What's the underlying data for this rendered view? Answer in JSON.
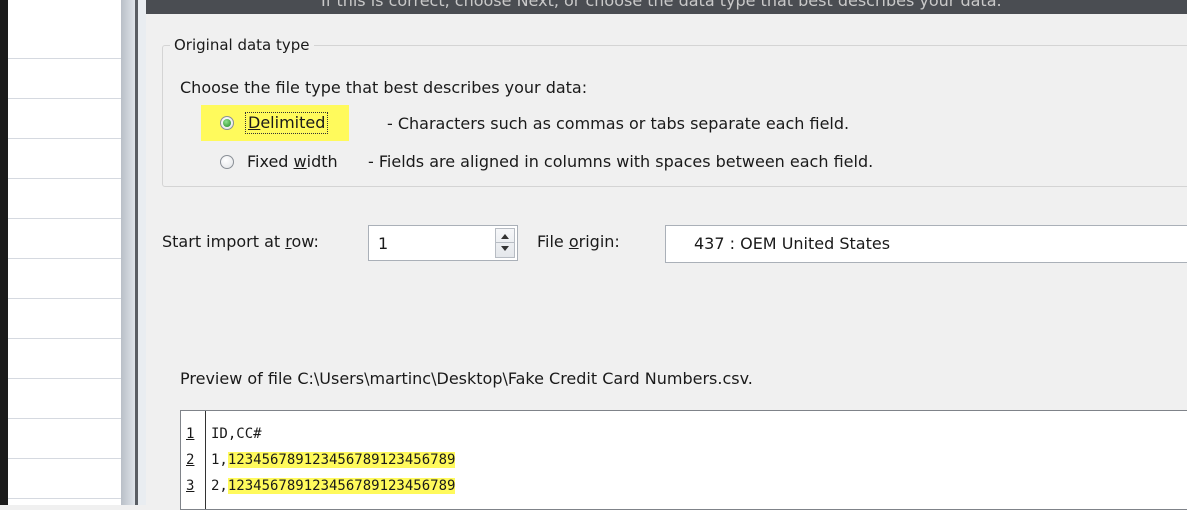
{
  "window": {
    "cutoff_text": "If this is correct, choose Next, or choose the data type that best describes your data."
  },
  "group": {
    "legend": "Original data type",
    "choose_text": "Choose the file type that best describes your data:",
    "delimited": {
      "label_pre": "",
      "label_key": "D",
      "label_post": "elimited",
      "description": "- Characters such as commas or tabs separate each field.",
      "selected": true
    },
    "fixed": {
      "label_pre": "Fixed ",
      "label_key": "w",
      "label_post": "idth",
      "description": "- Fields are aligned in columns with spaces between each field.",
      "selected": false
    }
  },
  "import": {
    "start_label_pre": "Start import at ",
    "start_label_key": "r",
    "start_label_post": "ow:",
    "start_row": "1",
    "origin_label_pre": "File ",
    "origin_label_key": "o",
    "origin_label_post": "rigin:",
    "origin_value": "437 : OEM United States"
  },
  "preview": {
    "label": "Preview of file C:\\Users\\martinc\\Desktop\\Fake Credit Card Numbers.csv.",
    "rows": [
      {
        "num": "1",
        "text_plain": "ID,CC#",
        "text_hl": ""
      },
      {
        "num": "2",
        "text_plain": "1,",
        "text_hl": "123456789123456789123456789"
      },
      {
        "num": "3",
        "text_plain": "2,",
        "text_hl": "123456789123456789123456789"
      }
    ]
  },
  "colors": {
    "highlight": "#fffa5c",
    "dialog_bg": "#f0f0f0",
    "radio_selected": "#1f8a1f"
  }
}
